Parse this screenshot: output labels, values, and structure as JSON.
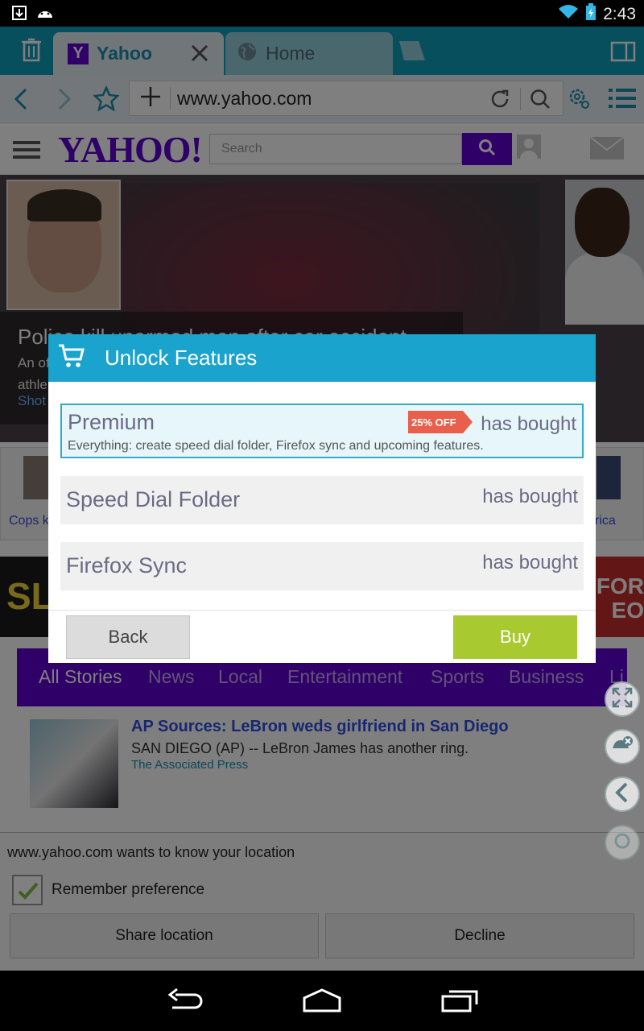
{
  "status_bar": {
    "time": "2:43"
  },
  "browser": {
    "tabs": [
      {
        "label": "Yahoo",
        "favicon": "Y",
        "active": true
      },
      {
        "label": "Home",
        "active": false
      }
    ],
    "url": "www.yahoo.com"
  },
  "yahoo": {
    "logo": "YAHOO!",
    "search_placeholder": "Search",
    "hero": {
      "headline": "Police kill unarmed man after car accident",
      "line1": "An of",
      "line2": "athle",
      "link": "Shot"
    },
    "strip": [
      {
        "label": "Cops k"
      },
      {
        "label": "rica"
      }
    ],
    "ad": {
      "left_text": "SLE",
      "right_text": "FOR\nEO"
    },
    "nav": [
      "All Stories",
      "News",
      "Local",
      "Entertainment",
      "Sports",
      "Business",
      "Li"
    ],
    "story": {
      "title": "AP Sources: LeBron weds girlfriend in San Diego",
      "desc": "SAN DIEGO (AP) -- LeBron James has another ring.",
      "source": "The Associated Press"
    }
  },
  "geo_prompt": {
    "question": "www.yahoo.com wants to know your location",
    "remember_label": "Remember preference",
    "remember_checked": true,
    "share_label": "Share location",
    "decline_label": "Decline"
  },
  "dialog": {
    "title": "Unlock Features",
    "options": [
      {
        "name": "Premium",
        "badge": "25% OFF",
        "status": "has bought",
        "desc": "Everything: create speed dial folder, Firefox sync and upcoming features."
      },
      {
        "name": "Speed Dial Folder",
        "status": "has bought"
      },
      {
        "name": "Firefox Sync",
        "status": "has bought"
      }
    ],
    "back_label": "Back",
    "buy_label": "Buy"
  },
  "colors": {
    "accent": "#109fbc",
    "dialog_header": "#1aa3cd",
    "buy_button": "#a9c930",
    "yahoo_purple": "#5f01d1",
    "badge": "#e8604c"
  }
}
